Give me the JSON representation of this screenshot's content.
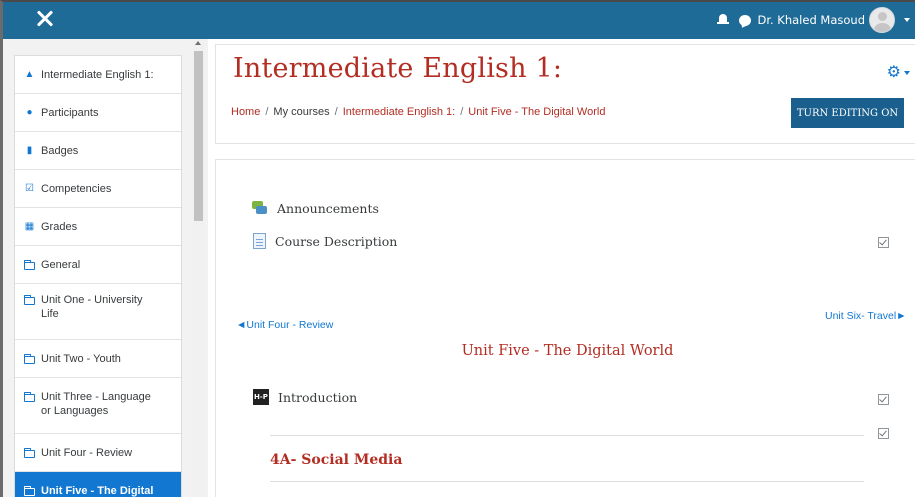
{
  "topbar": {
    "user_name": "Dr. Khaled Masoud"
  },
  "sidebar": {
    "items": [
      {
        "label": "Intermediate English 1:",
        "icon": "graduation-cap-icon"
      },
      {
        "label": "Participants",
        "icon": "users-icon"
      },
      {
        "label": "Badges",
        "icon": "shield-icon"
      },
      {
        "label": "Competencies",
        "icon": "check-square-icon"
      },
      {
        "label": "Grades",
        "icon": "table-icon"
      },
      {
        "label": "General",
        "icon": "folder-icon"
      },
      {
        "label": "Unit One - University Life",
        "icon": "folder-icon"
      },
      {
        "label": "Unit Two - Youth",
        "icon": "folder-icon"
      },
      {
        "label": "Unit Three - Language or Languages",
        "icon": "folder-icon"
      },
      {
        "label": "Unit Four - Review",
        "icon": "folder-icon"
      },
      {
        "label": "Unit Five - The Digital",
        "icon": "folder-icon",
        "active": true
      }
    ]
  },
  "header": {
    "title": "Intermediate English 1:",
    "breadcrumb": {
      "home": "Home",
      "my_courses": "My courses",
      "course": "Intermediate English 1:",
      "section": "Unit Five - The Digital World"
    },
    "edit_button": "TURN EDITING ON"
  },
  "content": {
    "activities": [
      {
        "label": "Announcements",
        "icon": "forum-icon"
      },
      {
        "label": "Course Description",
        "icon": "page-icon"
      }
    ],
    "prev_link": "◄Unit Four - Review",
    "next_link": "Unit Six- Travel►",
    "section_title": "Unit Five - The Digital World",
    "intro": {
      "label": "Introduction",
      "icon_text": "H-P"
    },
    "subsection": "4A- Social Media"
  },
  "colors": {
    "navbar": "#1f6b98",
    "accent": "#1177d1",
    "title_red": "#b32d22",
    "edit_button": "#1b5f8e"
  }
}
